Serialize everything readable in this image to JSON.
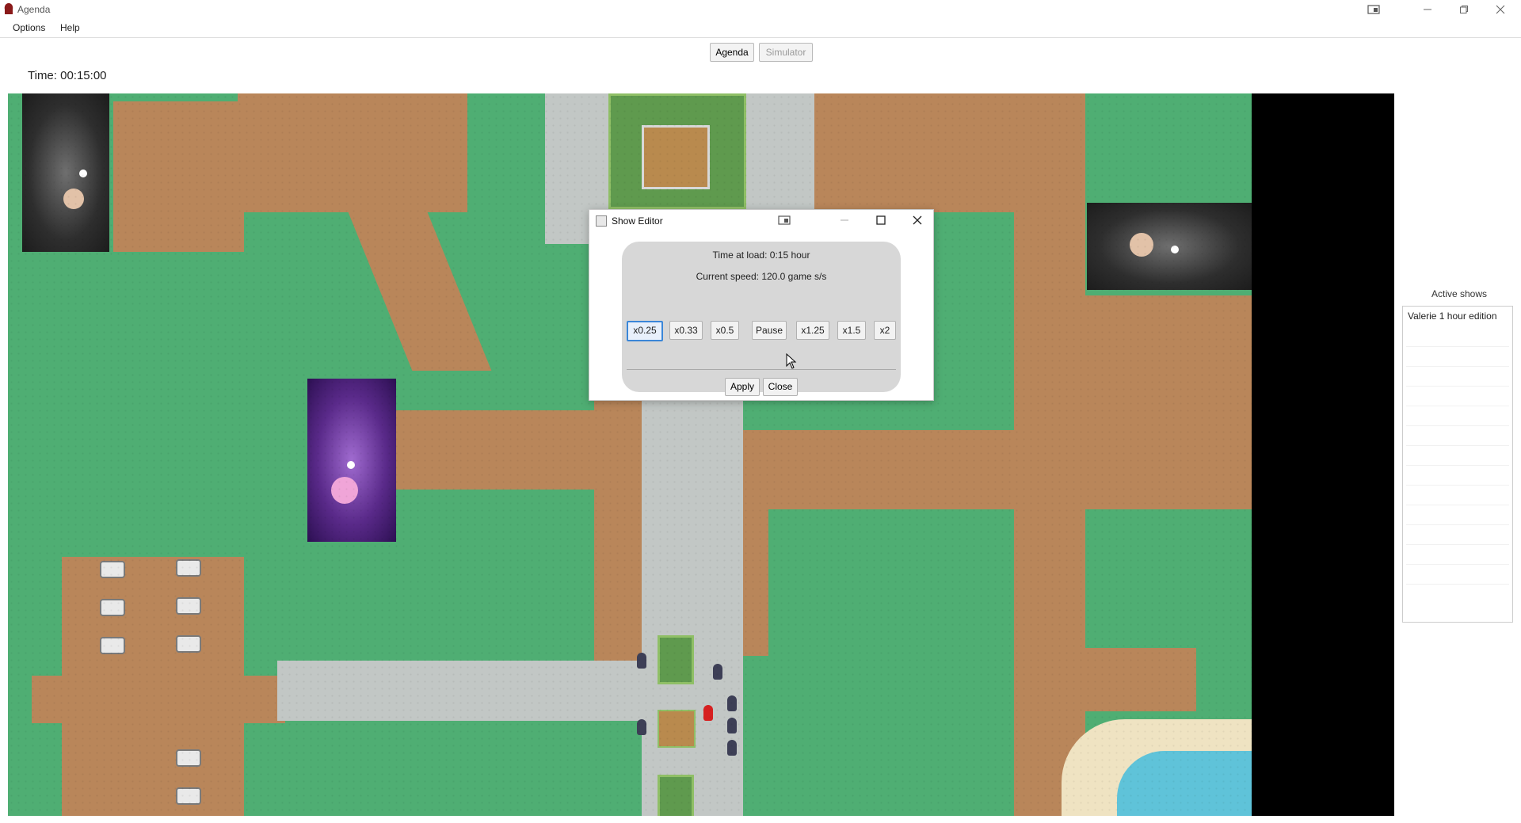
{
  "window": {
    "title": "Agenda",
    "controls": [
      "minimize",
      "restore",
      "close"
    ]
  },
  "menu": {
    "options": "Options",
    "help": "Help"
  },
  "tabs": {
    "agenda": "Agenda",
    "simulator": "Simulator"
  },
  "time_label": "Time: 00:15:00",
  "side_panel": {
    "title": "Active shows",
    "items": [
      "Valerie 1 hour edition"
    ]
  },
  "dialog": {
    "title": "Show Editor",
    "time_at_load": "Time at load: 0:15 hour",
    "current_speed": "Current speed: 120.0 game s/s",
    "speed_buttons": [
      "x0.25",
      "x0.33",
      "x0.5",
      "Pause",
      "x1.25",
      "x1.5",
      "x2"
    ],
    "selected_speed": "x0.25",
    "apply": "Apply",
    "close": "Close"
  },
  "colors": {
    "grass": "#4fae73",
    "path": "#b9865a",
    "stone": "#c2c7c5",
    "water": "#5fc3d9",
    "selection": "#3a86d8"
  }
}
